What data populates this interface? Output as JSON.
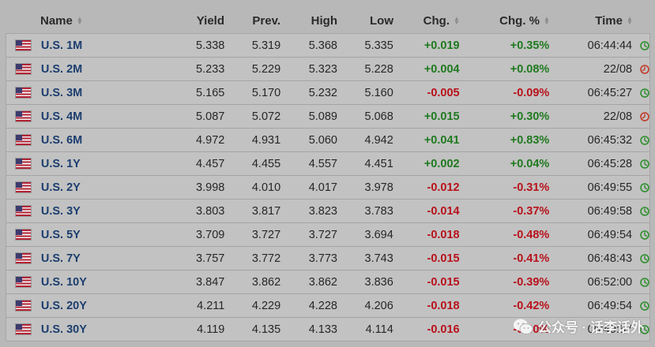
{
  "columns": {
    "name": "Name",
    "yield": "Yield",
    "prev": "Prev.",
    "high": "High",
    "low": "Low",
    "chg": "Chg.",
    "chg_pct": "Chg. %",
    "time": "Time"
  },
  "colors": {
    "positive": "#1f7a1f",
    "negative": "#b8121b",
    "open": "#2f8f2f",
    "closed": "#c23a2a"
  },
  "rows": [
    {
      "name": "U.S. 1M",
      "yield": "5.338",
      "prev": "5.319",
      "high": "5.368",
      "low": "5.335",
      "chg": "+0.019",
      "chg_pct": "+0.35%",
      "time": "06:44:44",
      "dir": "pos",
      "status": "open"
    },
    {
      "name": "U.S. 2M",
      "yield": "5.233",
      "prev": "5.229",
      "high": "5.323",
      "low": "5.228",
      "chg": "+0.004",
      "chg_pct": "+0.08%",
      "time": "22/08",
      "dir": "pos",
      "status": "closed"
    },
    {
      "name": "U.S. 3M",
      "yield": "5.165",
      "prev": "5.170",
      "high": "5.232",
      "low": "5.160",
      "chg": "-0.005",
      "chg_pct": "-0.09%",
      "time": "06:45:27",
      "dir": "neg",
      "status": "open"
    },
    {
      "name": "U.S. 4M",
      "yield": "5.087",
      "prev": "5.072",
      "high": "5.089",
      "low": "5.068",
      "chg": "+0.015",
      "chg_pct": "+0.30%",
      "time": "22/08",
      "dir": "pos",
      "status": "closed"
    },
    {
      "name": "U.S. 6M",
      "yield": "4.972",
      "prev": "4.931",
      "high": "5.060",
      "low": "4.942",
      "chg": "+0.041",
      "chg_pct": "+0.83%",
      "time": "06:45:32",
      "dir": "pos",
      "status": "open"
    },
    {
      "name": "U.S. 1Y",
      "yield": "4.457",
      "prev": "4.455",
      "high": "4.557",
      "low": "4.451",
      "chg": "+0.002",
      "chg_pct": "+0.04%",
      "time": "06:45:28",
      "dir": "pos",
      "status": "open"
    },
    {
      "name": "U.S. 2Y",
      "yield": "3.998",
      "prev": "4.010",
      "high": "4.017",
      "low": "3.978",
      "chg": "-0.012",
      "chg_pct": "-0.31%",
      "time": "06:49:55",
      "dir": "neg",
      "status": "open"
    },
    {
      "name": "U.S. 3Y",
      "yield": "3.803",
      "prev": "3.817",
      "high": "3.823",
      "low": "3.783",
      "chg": "-0.014",
      "chg_pct": "-0.37%",
      "time": "06:49:58",
      "dir": "neg",
      "status": "open"
    },
    {
      "name": "U.S. 5Y",
      "yield": "3.709",
      "prev": "3.727",
      "high": "3.727",
      "low": "3.694",
      "chg": "-0.018",
      "chg_pct": "-0.48%",
      "time": "06:49:54",
      "dir": "neg",
      "status": "open"
    },
    {
      "name": "U.S. 7Y",
      "yield": "3.757",
      "prev": "3.772",
      "high": "3.773",
      "low": "3.743",
      "chg": "-0.015",
      "chg_pct": "-0.41%",
      "time": "06:48:43",
      "dir": "neg",
      "status": "open"
    },
    {
      "name": "U.S. 10Y",
      "yield": "3.847",
      "prev": "3.862",
      "high": "3.862",
      "low": "3.836",
      "chg": "-0.015",
      "chg_pct": "-0.39%",
      "time": "06:52:00",
      "dir": "neg",
      "status": "open"
    },
    {
      "name": "U.S. 20Y",
      "yield": "4.211",
      "prev": "4.229",
      "high": "4.228",
      "low": "4.206",
      "chg": "-0.018",
      "chg_pct": "-0.42%",
      "time": "06:49:54",
      "dir": "neg",
      "status": "open"
    },
    {
      "name": "U.S. 30Y",
      "yield": "4.119",
      "prev": "4.135",
      "high": "4.133",
      "low": "4.114",
      "chg": "-0.016",
      "chg_pct": "-0.40%",
      "time": "06:49:57",
      "dir": "neg",
      "status": "open"
    }
  ],
  "watermark": {
    "text": "公众号 · 话李话外",
    "icon": "wechat-icon"
  }
}
